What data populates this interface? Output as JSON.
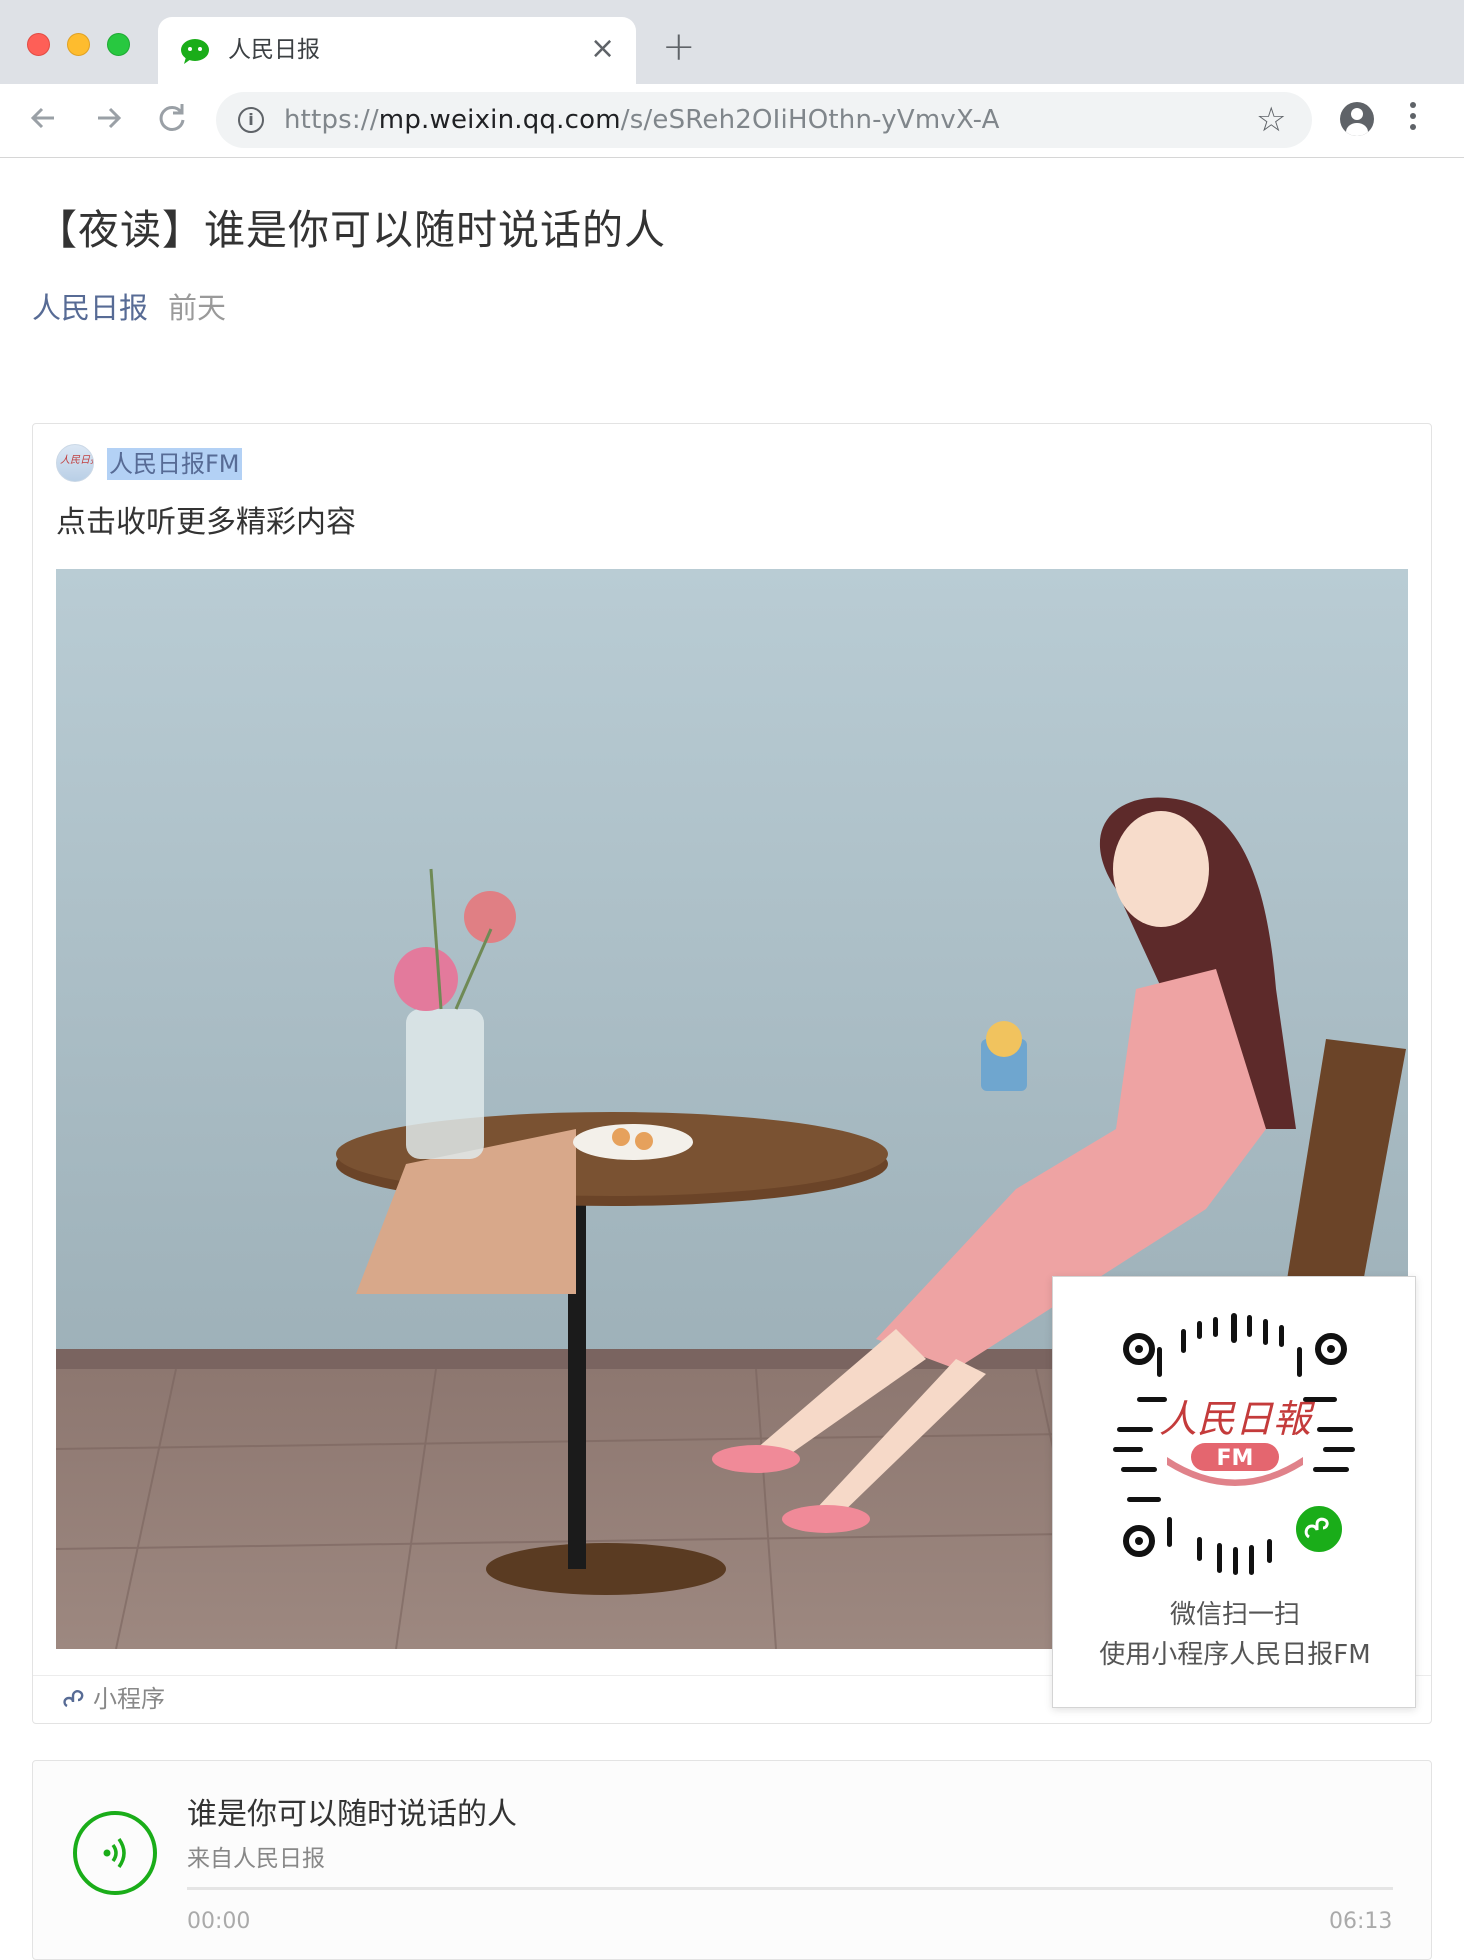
{
  "browser": {
    "tab_title": "人民日报",
    "tab_close": "×",
    "new_tab": "+",
    "url_prefix": "https://",
    "url_host": "mp.weixin.qq.com",
    "url_path": "/s/eSReh2OIiHOthn-yVmvX-A",
    "icons": {
      "back": "back-arrow-icon",
      "forward": "forward-arrow-icon",
      "reload": "reload-icon",
      "info": "info-icon",
      "bookmark": "star-icon",
      "profile": "account-icon",
      "menu": "more-vert-icon"
    }
  },
  "article": {
    "title": "【夜读】谁是你可以随时说话的人",
    "author": "人民日报",
    "date": "前天"
  },
  "mini_program": {
    "name": "人民日报FM",
    "description": "点击收听更多精彩内容",
    "footer_label": "小程序",
    "avatar_text": "人民日报FM",
    "qr": {
      "line1": "微信扫一扫",
      "line2": "使用小程序人民日报FM",
      "logo_text": "人民日報",
      "logo_badge": "FM"
    }
  },
  "audio": {
    "title": "谁是你可以随时说话的人",
    "source": "来自人民日报",
    "current_time": "00:00",
    "duration": "06:13",
    "progress": 0
  },
  "colors": {
    "link": "#576b95",
    "wechat_green": "#1aad19",
    "tab_strip": "#dee1e6"
  }
}
